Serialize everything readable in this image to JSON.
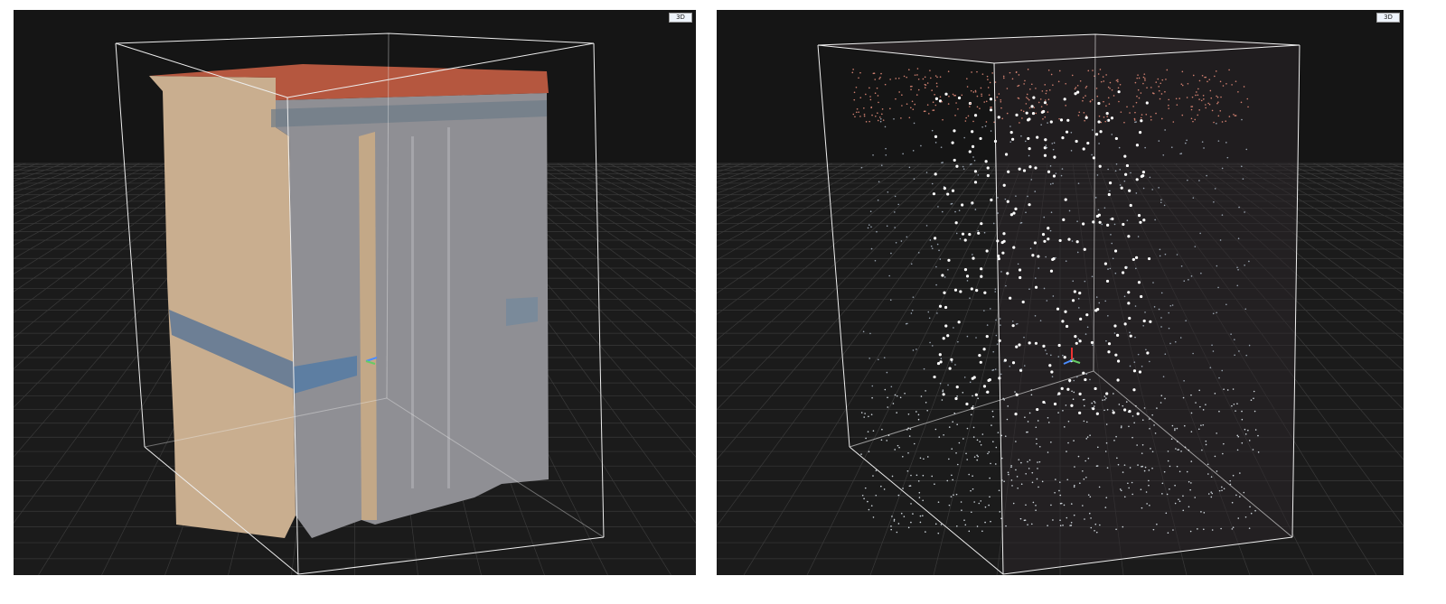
{
  "left_view": {
    "mode_label": "3D",
    "background": "#1b1b1b",
    "box_color": "#ffffff"
  },
  "right_view": {
    "mode_label": "3D",
    "background": "#1b1b1b",
    "box_color": "#ffffff"
  }
}
